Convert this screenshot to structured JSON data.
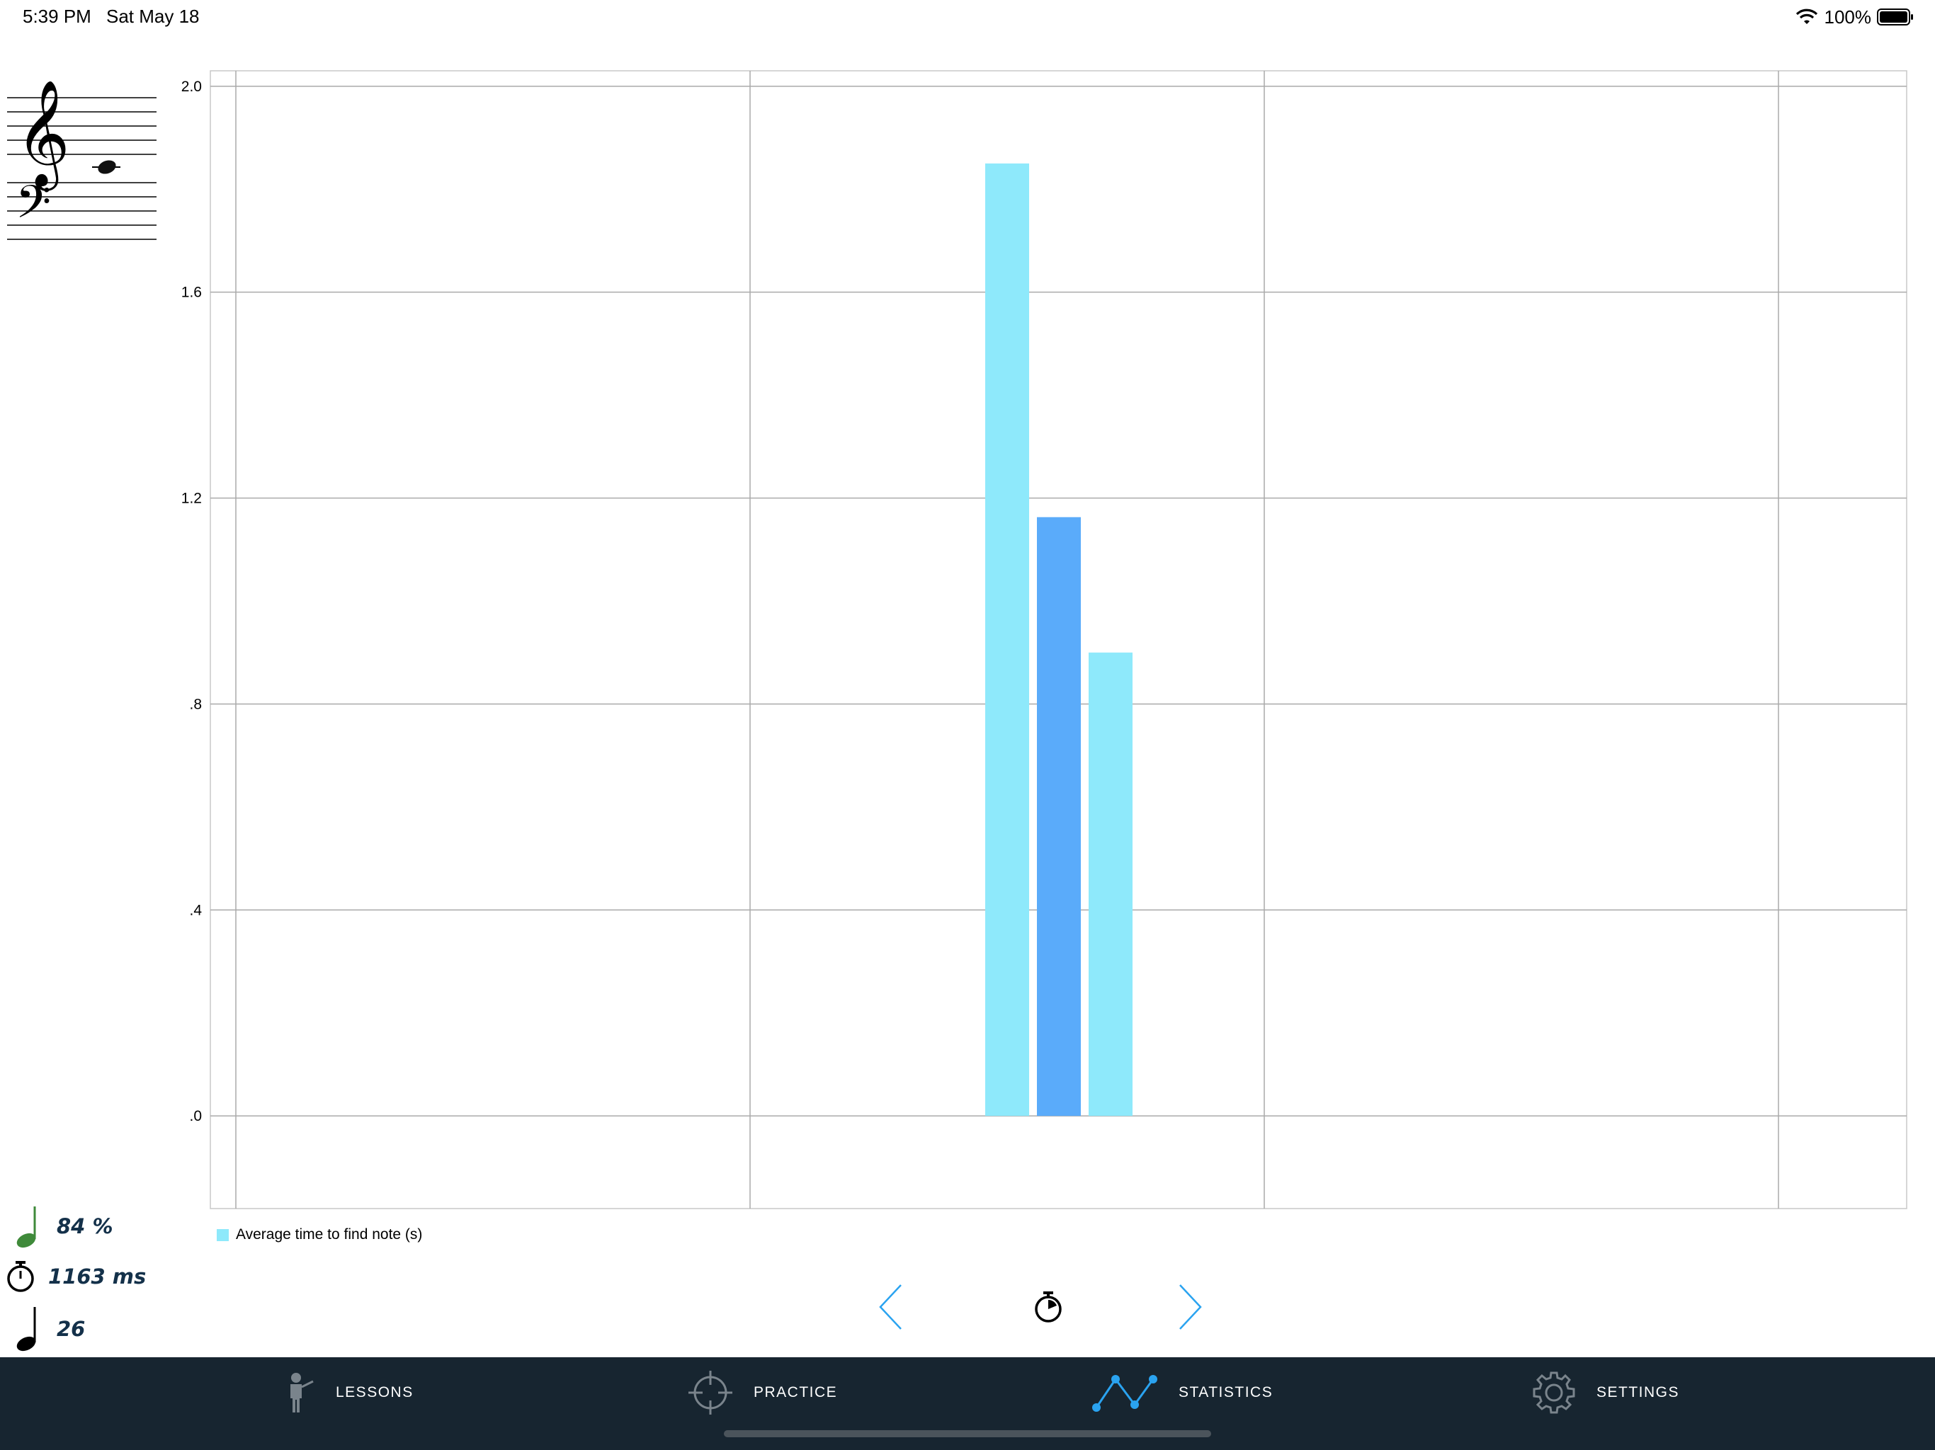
{
  "status_bar": {
    "time": "5:39 PM",
    "date": "Sat May 18",
    "battery": "100%"
  },
  "staff": {
    "clefs": [
      "treble-clef",
      "bass-clef"
    ],
    "note": "C4 (middle C, ledger line)"
  },
  "chart_data": {
    "type": "bar",
    "categories": [
      "",
      "",
      ""
    ],
    "values": [
      1.85,
      1.163,
      0.9
    ],
    "bar_colors": [
      "#8ee9fb",
      "#5aabfa",
      "#8ee9fb"
    ],
    "ylim": [
      -0.18,
      2.03
    ],
    "yticks": [
      2.0,
      1.6,
      1.2,
      0.8,
      0.4,
      0.0
    ],
    "ytick_labels": [
      "2.0",
      "1.6",
      "1.2",
      ".8",
      ".4",
      ".0"
    ],
    "grid": true,
    "legend": {
      "placement": "bottom-left",
      "entries": [
        {
          "label": "Average time to find note (s)",
          "color": "#8ee9fb"
        }
      ]
    }
  },
  "stats": {
    "accuracy": "84 %",
    "time": "1163 ms",
    "count": "26",
    "accuracy_color": "#3f8a3a"
  },
  "navigation": {
    "prev_icon": "chevron-left-icon",
    "mode_icon": "stopwatch-icon",
    "next_icon": "chevron-right-icon",
    "accent": "#2aa3f0"
  },
  "tabs": [
    {
      "label": "LESSONS",
      "icon": "teacher-icon"
    },
    {
      "label": "PRACTICE",
      "icon": "crosshair-icon"
    },
    {
      "label": "STATISTICS",
      "icon": "line-chart-icon",
      "active": true
    },
    {
      "label": "SETTINGS",
      "icon": "gear-icon"
    }
  ]
}
